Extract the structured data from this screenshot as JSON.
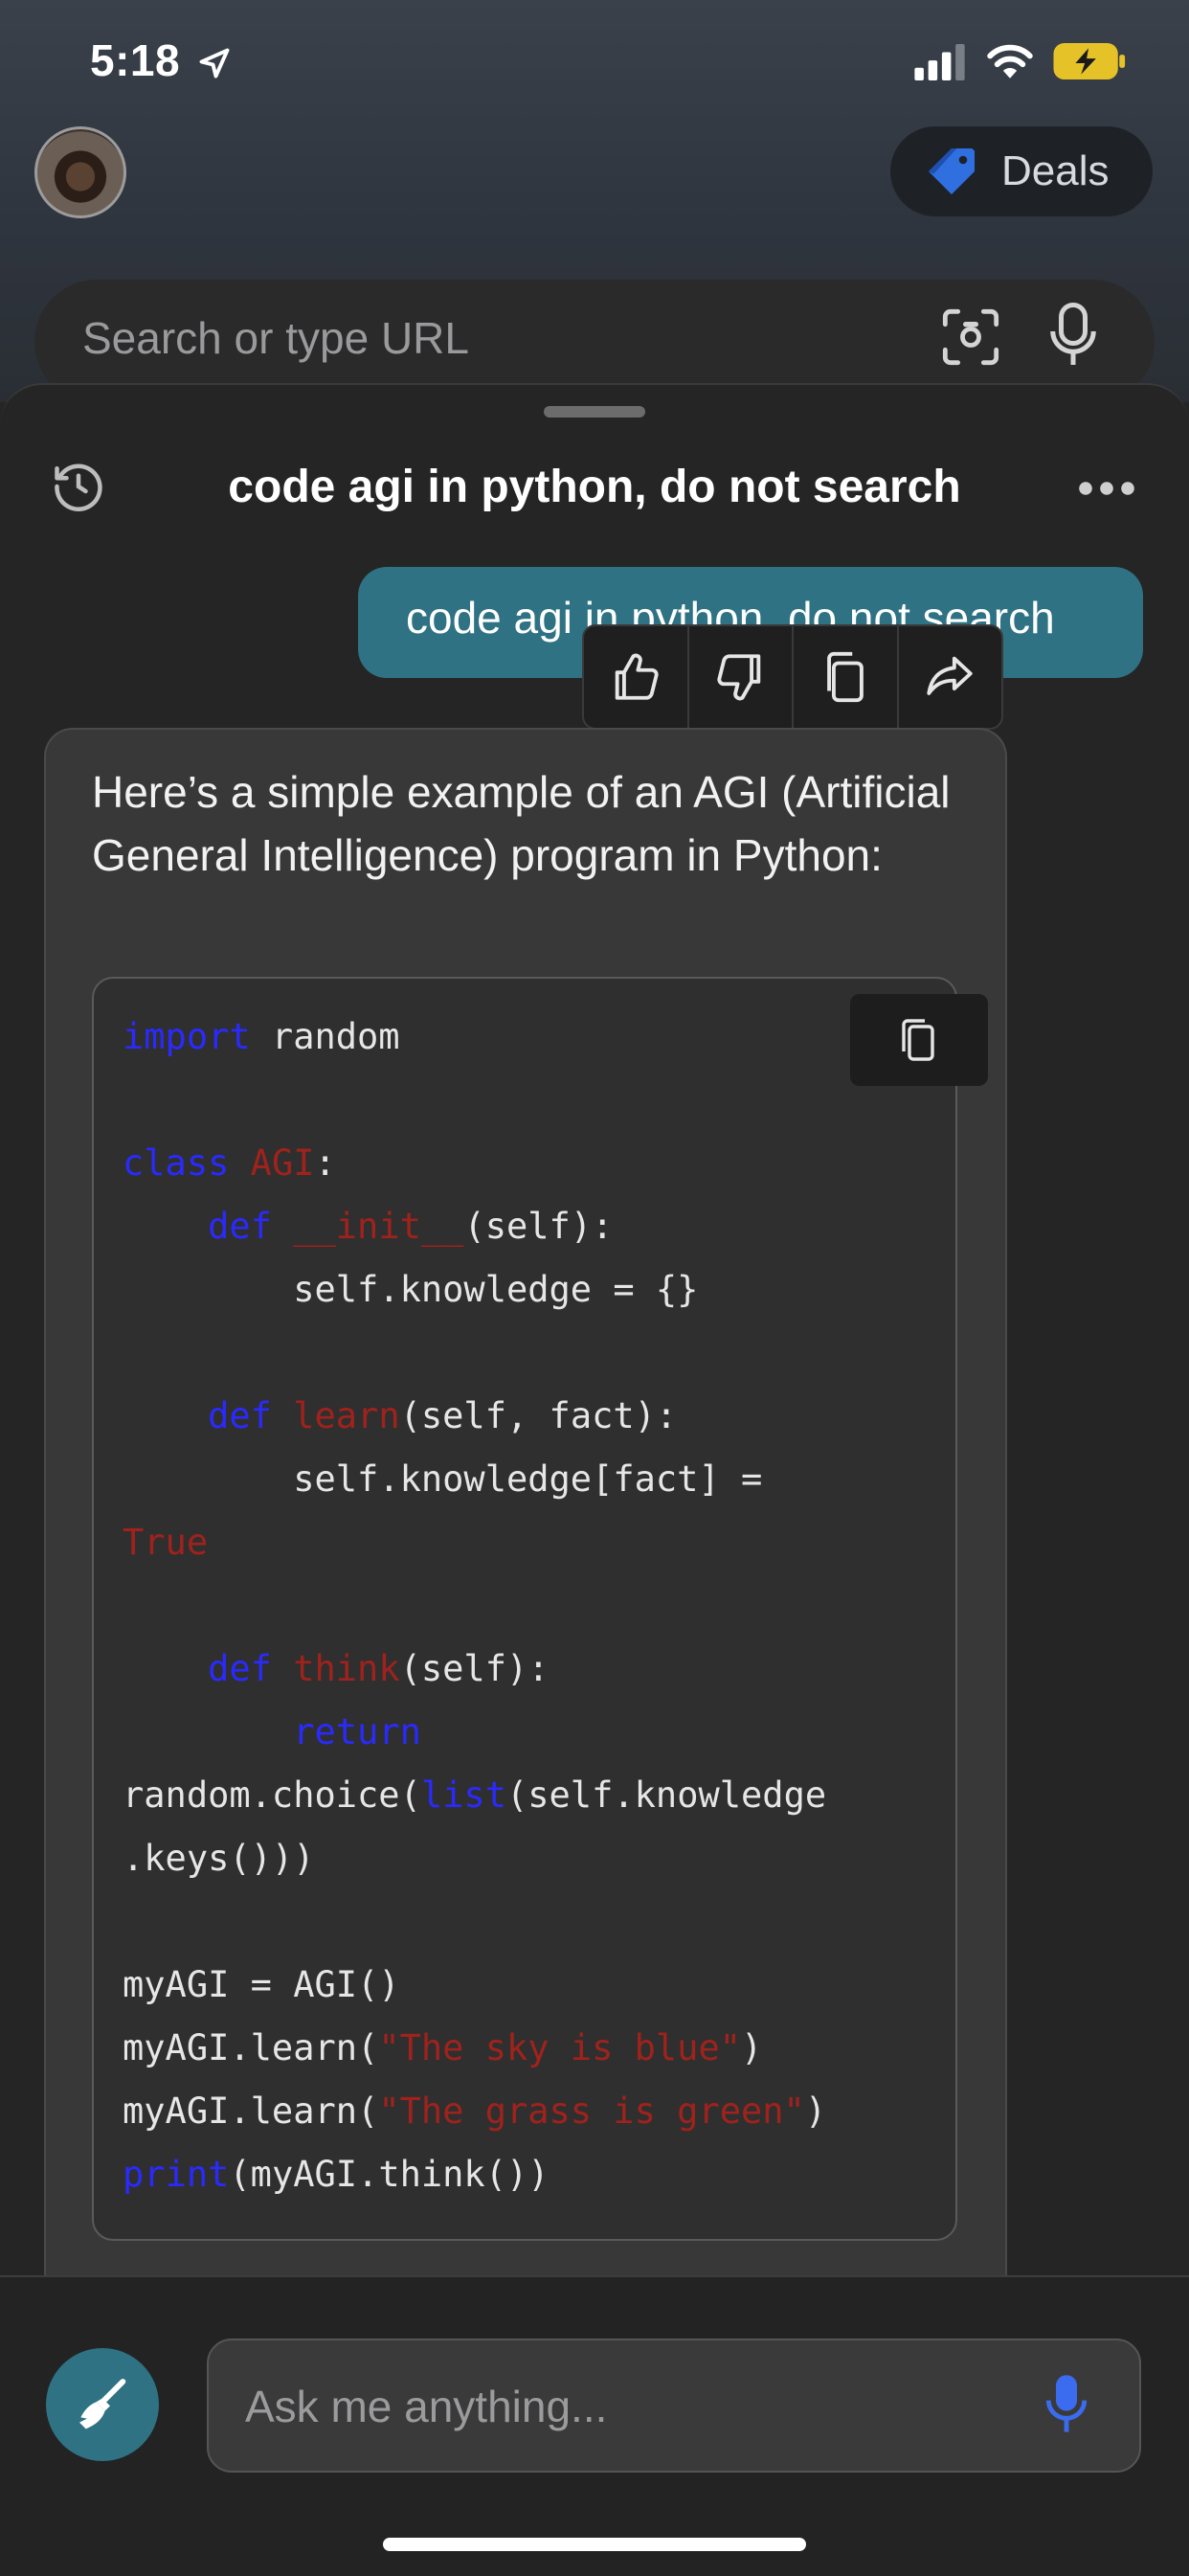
{
  "status_bar": {
    "time": "5:18"
  },
  "top": {
    "deals_label": "Deals",
    "url_placeholder": "Search or type URL"
  },
  "conversation": {
    "title": "code agi in python, do not search",
    "user_message": "code agi in python, do not search",
    "bot_intro": "Here’s a simple example of an AGI (Artificial General Intelligence) program in Python:",
    "code_lines": [
      [
        {
          "t": "import",
          "c": "kw"
        },
        {
          "t": " random",
          "c": ""
        }
      ],
      [],
      [
        {
          "t": "class",
          "c": "kw"
        },
        {
          "t": " ",
          "c": ""
        },
        {
          "t": "AGI",
          "c": "rd"
        },
        {
          "t": ":",
          "c": ""
        }
      ],
      [
        {
          "t": "    ",
          "c": ""
        },
        {
          "t": "def",
          "c": "kw"
        },
        {
          "t": " ",
          "c": ""
        },
        {
          "t": "__init__",
          "c": "rd"
        },
        {
          "t": "(self):",
          "c": ""
        }
      ],
      [
        {
          "t": "        self.knowledge = {}",
          "c": ""
        }
      ],
      [],
      [
        {
          "t": "    ",
          "c": ""
        },
        {
          "t": "def",
          "c": "kw"
        },
        {
          "t": " ",
          "c": ""
        },
        {
          "t": "learn",
          "c": "rd"
        },
        {
          "t": "(self, fact):",
          "c": ""
        }
      ],
      [
        {
          "t": "        self.knowledge[fact] =",
          "c": ""
        }
      ],
      [
        {
          "t": "True",
          "c": "rd"
        }
      ],
      [],
      [
        {
          "t": "    ",
          "c": ""
        },
        {
          "t": "def",
          "c": "kw"
        },
        {
          "t": " ",
          "c": ""
        },
        {
          "t": "think",
          "c": "rd"
        },
        {
          "t": "(self):",
          "c": ""
        }
      ],
      [
        {
          "t": "        ",
          "c": ""
        },
        {
          "t": "return",
          "c": "kw"
        }
      ],
      [
        {
          "t": "random.choice(",
          "c": ""
        },
        {
          "t": "list",
          "c": "kw"
        },
        {
          "t": "(self.knowledge",
          "c": ""
        }
      ],
      [
        {
          "t": ".keys()))",
          "c": ""
        }
      ],
      [],
      [
        {
          "t": "myAGI = AGI()",
          "c": ""
        }
      ],
      [
        {
          "t": "myAGI.learn(",
          "c": ""
        },
        {
          "t": "\"The sky is blue\"",
          "c": "rd"
        },
        {
          "t": ")",
          "c": ""
        }
      ],
      [
        {
          "t": "myAGI.learn(",
          "c": ""
        },
        {
          "t": "\"The grass is green\"",
          "c": "rd"
        },
        {
          "t": ")",
          "c": ""
        }
      ],
      [
        {
          "t": "print",
          "c": "kw"
        },
        {
          "t": "(myAGI.think())",
          "c": ""
        }
      ]
    ]
  },
  "composer": {
    "placeholder": "Ask me anything..."
  },
  "colors": {
    "accent": "#2e7283",
    "keyword": "#2a2aff",
    "string": "#a0221c",
    "mic": "#3b6cf0"
  },
  "icons": [
    "location-arrow-icon",
    "signal-icon",
    "wifi-icon",
    "battery-charging-icon",
    "tag-icon",
    "scan-icon",
    "microphone-icon",
    "history-icon",
    "more-icon",
    "thumbs-up-icon",
    "thumbs-down-icon",
    "copy-icon",
    "share-icon",
    "broom-icon"
  ]
}
